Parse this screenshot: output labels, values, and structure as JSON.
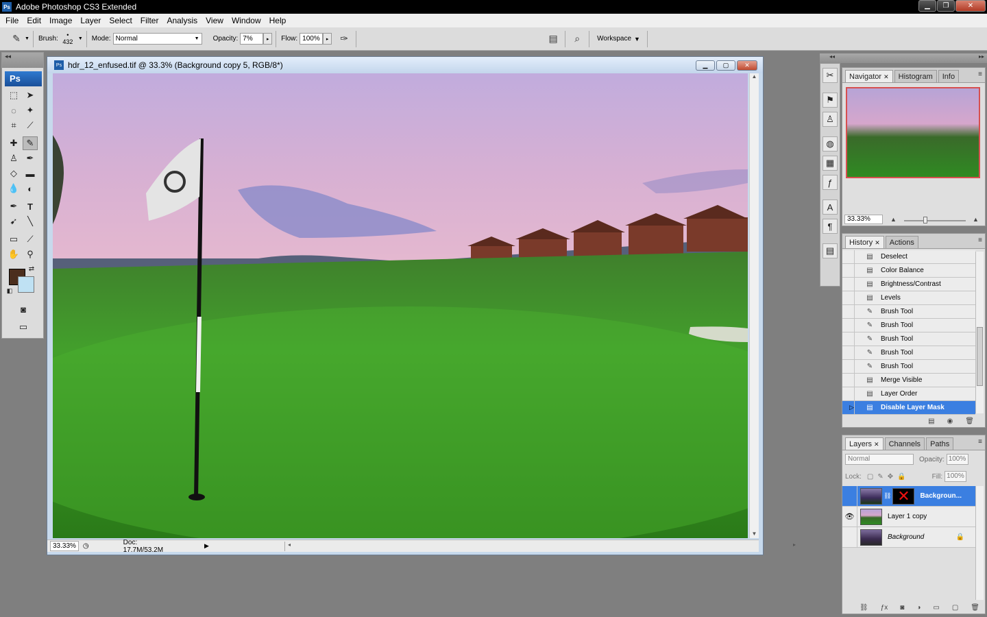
{
  "app": {
    "title": "Adobe Photoshop CS3 Extended",
    "icon_text": "Ps"
  },
  "menu": [
    "File",
    "Edit",
    "Image",
    "Layer",
    "Select",
    "Filter",
    "Analysis",
    "View",
    "Window",
    "Help"
  ],
  "options": {
    "brush_label": "Brush:",
    "brush_size": "432",
    "mode_label": "Mode:",
    "mode_value": "Normal",
    "opacity_label": "Opacity:",
    "opacity_value": "7%",
    "flow_label": "Flow:",
    "flow_value": "100%",
    "workspace_label": "Workspace"
  },
  "toolbox": {
    "logo": "Ps"
  },
  "colors": {
    "foreground": "#4b2e1d",
    "background": "#bfe1f3",
    "selection": "#3b7fe1"
  },
  "document": {
    "title": "hdr_12_enfused.tif @ 33.3% (Background copy 5, RGB/8*)",
    "icon_text": "Ps",
    "zoom": "33.33%",
    "doc_info": "Doc: 17.7M/53.2M"
  },
  "navigator": {
    "tabs": [
      "Navigator",
      "Histogram",
      "Info"
    ],
    "zoom": "33.33%"
  },
  "history": {
    "tabs": [
      "History",
      "Actions"
    ],
    "items": [
      {
        "label": "Deselect",
        "icon": "history-state-icon"
      },
      {
        "label": "Color Balance",
        "icon": "history-state-icon"
      },
      {
        "label": "Brightness/Contrast",
        "icon": "history-state-icon"
      },
      {
        "label": "Levels",
        "icon": "history-state-icon"
      },
      {
        "label": "Brush Tool",
        "icon": "brush-icon"
      },
      {
        "label": "Brush Tool",
        "icon": "brush-icon"
      },
      {
        "label": "Brush Tool",
        "icon": "brush-icon"
      },
      {
        "label": "Brush Tool",
        "icon": "brush-icon"
      },
      {
        "label": "Brush Tool",
        "icon": "brush-icon"
      },
      {
        "label": "Merge Visible",
        "icon": "history-state-icon"
      },
      {
        "label": "Layer Order",
        "icon": "history-state-icon"
      },
      {
        "label": "Disable Layer Mask",
        "icon": "history-state-icon",
        "selected": true
      }
    ]
  },
  "layers": {
    "tabs": [
      "Layers",
      "Channels",
      "Paths"
    ],
    "blend_mode": "Normal",
    "opacity_label": "Opacity:",
    "opacity_value": "100%",
    "lock_label": "Lock:",
    "fill_label": "Fill:",
    "fill_value": "100%",
    "items": [
      {
        "name": "Backgroun...",
        "visible": false,
        "selected": true,
        "has_mask": true
      },
      {
        "name": "Layer 1 copy",
        "visible": true,
        "selected": false
      },
      {
        "name": "Background",
        "visible": false,
        "selected": false,
        "locked": true
      }
    ]
  }
}
